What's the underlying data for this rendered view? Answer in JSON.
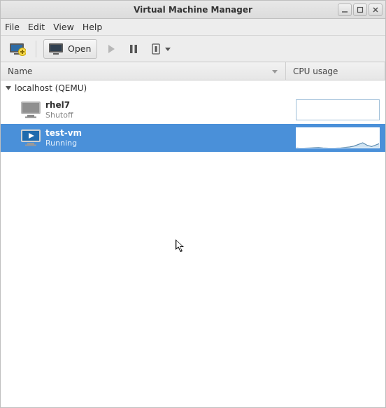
{
  "window": {
    "title": "Virtual Machine Manager"
  },
  "menubar": {
    "file": "File",
    "edit": "Edit",
    "view": "View",
    "help": "Help"
  },
  "toolbar": {
    "open_label": "Open"
  },
  "columns": {
    "name": "Name",
    "cpu": "CPU usage"
  },
  "host": {
    "label": "localhost (QEMU)"
  },
  "vms": [
    {
      "name": "rhel7",
      "status": "Shutoff"
    },
    {
      "name": "test-vm",
      "status": "Running"
    }
  ],
  "chart_data": [
    {
      "type": "area",
      "title": "CPU usage — rhel7",
      "ylim": [
        0,
        100
      ],
      "values": [
        0,
        0,
        0,
        0,
        0,
        0,
        0,
        0,
        0,
        0,
        0,
        0,
        0,
        0,
        0,
        0,
        0,
        0,
        0,
        0
      ]
    },
    {
      "type": "area",
      "title": "CPU usage — test-vm",
      "ylim": [
        0,
        100
      ],
      "values": [
        6,
        4,
        5,
        6,
        7,
        8,
        6,
        5,
        4,
        5,
        6,
        8,
        10,
        14,
        22,
        30,
        18,
        12,
        20,
        28
      ]
    }
  ]
}
